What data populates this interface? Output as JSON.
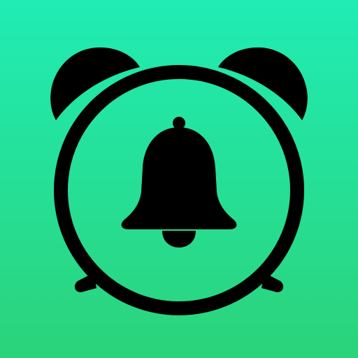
{
  "app_icon": {
    "icon": "alarm-clock-bell-icon",
    "colors": {
      "background_top": "#20ecb4",
      "background_bottom": "#2bd37a",
      "glyph": "#000000"
    }
  }
}
